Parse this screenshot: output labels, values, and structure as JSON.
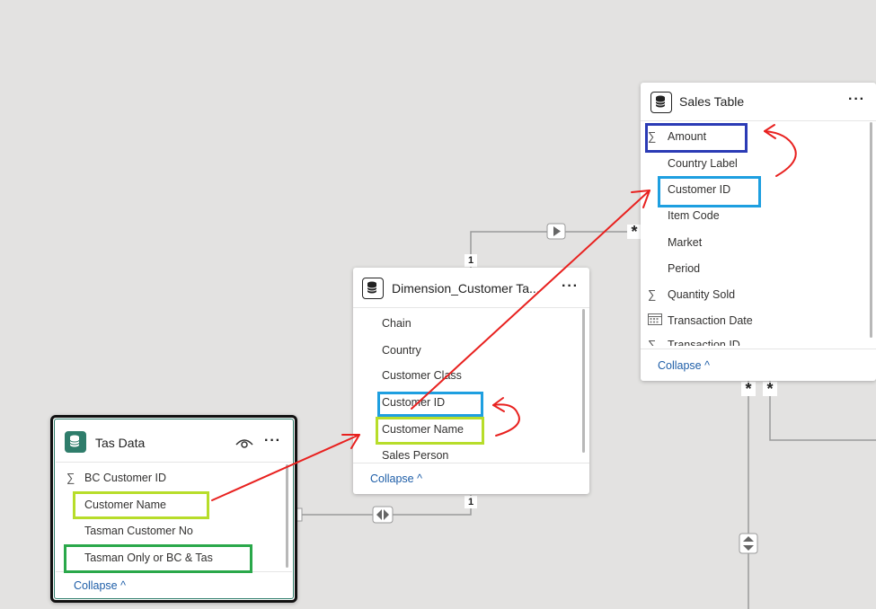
{
  "sales_table": {
    "title": "Sales Table",
    "fields": [
      {
        "label": "Amount",
        "icon": "sum-icon"
      },
      {
        "label": "Country Label",
        "icon": ""
      },
      {
        "label": "Customer ID",
        "icon": ""
      },
      {
        "label": "Item Code",
        "icon": ""
      },
      {
        "label": "Market",
        "icon": ""
      },
      {
        "label": "Period",
        "icon": ""
      },
      {
        "label": "Quantity Sold",
        "icon": "sum-icon"
      },
      {
        "label": "Transaction Date",
        "icon": "calendar-icon"
      },
      {
        "label": "Transaction ID",
        "icon": "sum-icon"
      }
    ],
    "collapse": "Collapse ^"
  },
  "dimension_customer": {
    "title": "Dimension_Customer Ta...",
    "fields": [
      {
        "label": "Chain"
      },
      {
        "label": "Country"
      },
      {
        "label": "Customer Class"
      },
      {
        "label": "Customer ID"
      },
      {
        "label": "Customer Name"
      },
      {
        "label": "Sales Person"
      }
    ],
    "collapse": "Collapse ^"
  },
  "tas_data": {
    "title": "Tas Data",
    "fields": [
      {
        "label": "BC Customer ID",
        "icon": "sum-icon"
      },
      {
        "label": "Customer Name",
        "icon": ""
      },
      {
        "label": "Tasman Customer No",
        "icon": ""
      },
      {
        "label": "Tasman Only or BC & Tas",
        "icon": ""
      }
    ],
    "collapse": "Collapse ^"
  },
  "relationship_labels": {
    "one_top": "1",
    "many_sales": "*",
    "one_mid": "1",
    "many_bottom_a": "*",
    "many_bottom_b": "*"
  },
  "icons": {
    "more": "···",
    "sum": "∑",
    "eye": "eye-icon"
  },
  "colors": {
    "highlight_blue": "#1e9fe0",
    "highlight_navy": "#2b3bb5",
    "highlight_lime": "#b7dd2a",
    "highlight_green": "#2aa84a",
    "arrow_red": "#e8211f",
    "tas_border": "#111111",
    "tas_accent": "#2f7d6b"
  }
}
